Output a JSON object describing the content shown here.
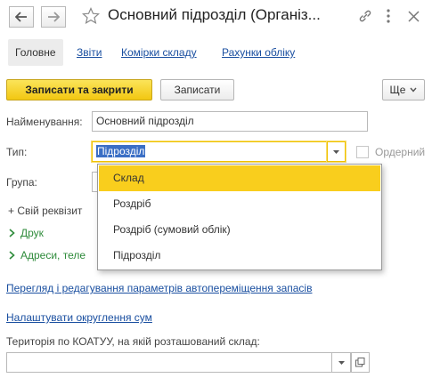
{
  "window": {
    "title": "Основний підрозділ (Організ..."
  },
  "tabs": {
    "main": "Головне",
    "reports": "Звіти",
    "cells": "Комірки складу",
    "accounts": "Рахунки обліку"
  },
  "toolbar": {
    "save_close": "Записати та закрити",
    "save": "Записати",
    "more": "Ще"
  },
  "form": {
    "name_label": "Найменування:",
    "name_value": "Основний підрозділ",
    "type_label": "Тип:",
    "type_value": "Підрозділ",
    "ordering_label": "Ордерний",
    "group_label": "Група:",
    "custom_attr": "+ Свій реквізит",
    "print_group": "Друк",
    "address_group": "Адреси, теле"
  },
  "dropdown": {
    "options": [
      "Склад",
      "Роздріб",
      "Роздріб (сумовий облік)",
      "Підрозділ"
    ],
    "highlighted_index": 0
  },
  "links": {
    "auto_transfer": "Перегляд і редагування параметрів автопереміщення запасів",
    "rounding": "Налаштувати округлення сум"
  },
  "koatuu": {
    "label": "Територія по КОАТУУ, на якій розташований склад:",
    "value": ""
  },
  "colors": {
    "accent_yellow": "#f2c711",
    "link_blue": "#1a4fa0",
    "group_green": "#2e8b3a",
    "selection_blue": "#3b6fc5"
  }
}
